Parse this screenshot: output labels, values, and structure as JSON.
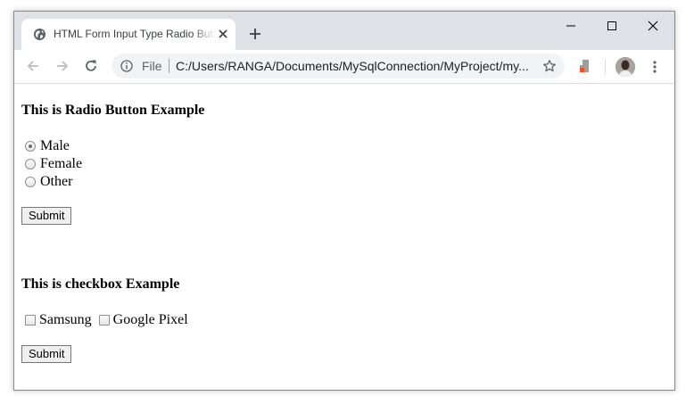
{
  "browser": {
    "tab_title": "HTML Form Input Type Radio Button",
    "omnibox": {
      "scheme_label": "File",
      "url": "C:/Users/RANGA/Documents/MySqlConnection/MyProject/my..."
    }
  },
  "page": {
    "radio_section": {
      "heading": "This is Radio Button Example",
      "options": [
        {
          "label": "Male",
          "checked": true
        },
        {
          "label": "Female",
          "checked": false
        },
        {
          "label": "Other",
          "checked": false
        }
      ],
      "submit_label": "Submit"
    },
    "checkbox_section": {
      "heading": "This is checkbox Example",
      "options": [
        {
          "label": "Samsung",
          "checked": false
        },
        {
          "label": "Google Pixel",
          "checked": false
        }
      ],
      "submit_label": "Submit"
    }
  },
  "icons": [
    "globe-icon",
    "close-icon",
    "plus-icon",
    "minimize-icon",
    "maximize-icon",
    "window-close-icon",
    "back-icon",
    "forward-icon",
    "reload-icon",
    "info-icon",
    "star-icon",
    "extension-icon",
    "avatar",
    "more-menu-icon"
  ],
  "colors": {
    "titlebar_bg": "#dee1e6",
    "omnibox_bg": "#f1f3f4",
    "extension_accent": "#f4511e"
  }
}
